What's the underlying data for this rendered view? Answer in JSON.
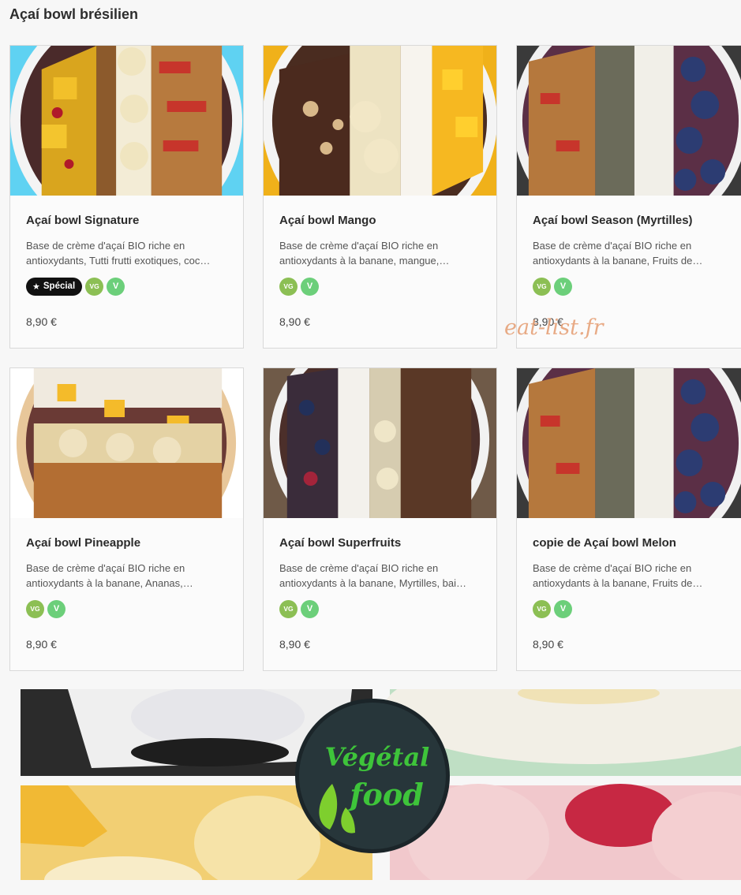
{
  "section": {
    "title": "Açaí bowl brésilien"
  },
  "products": [
    {
      "name": "Açaí bowl Signature",
      "description": "Base de crème d'açaí BIO riche en antioxydants, Tutti frutti exotiques, coc…",
      "special": "Spécial",
      "diet_vg": "VG",
      "diet_v": "V",
      "price": "8,90 €"
    },
    {
      "name": "Açaí bowl Mango",
      "description": "Base de crème d'açaí BIO riche en antioxydants à la banane, mangue,…",
      "diet_vg": "VG",
      "diet_v": "V",
      "price": "8,90 €"
    },
    {
      "name": "Açaí bowl Season (Myrtilles)",
      "description": "Base de crème d'açaí BIO riche en antioxydants à la banane, Fruits de…",
      "diet_vg": "VG",
      "diet_v": "V",
      "price": "8,90 €"
    },
    {
      "name": "Açaí bowl Pineapple",
      "description": "Base de crème d'açaí BIO riche en antioxydants à la banane, Ananas,…",
      "diet_vg": "VG",
      "diet_v": "V",
      "price": "8,90 €"
    },
    {
      "name": "Açaí bowl Superfruits",
      "description": "Base de crème d'açaí BIO riche en antioxydants à la banane, Myrtilles, bai…",
      "diet_vg": "VG",
      "diet_v": "V",
      "price": "8,90 €"
    },
    {
      "name": "copie de Açaí bowl Melon",
      "description": "Base de crème d'açaí BIO riche en antioxydants à la banane, Fruits de…",
      "diet_vg": "VG",
      "diet_v": "V",
      "price": "8,90 €"
    }
  ],
  "watermark": "eat-list.fr",
  "banner": {
    "logo_line1": "Végétal",
    "logo_line2": "food"
  },
  "colors": {
    "badge_vg": "#8cbf54",
    "badge_v": "#6ccf7a",
    "special_badge": "#111111",
    "logo_green": "#3ec43a",
    "logo_bg": "#27363a"
  }
}
